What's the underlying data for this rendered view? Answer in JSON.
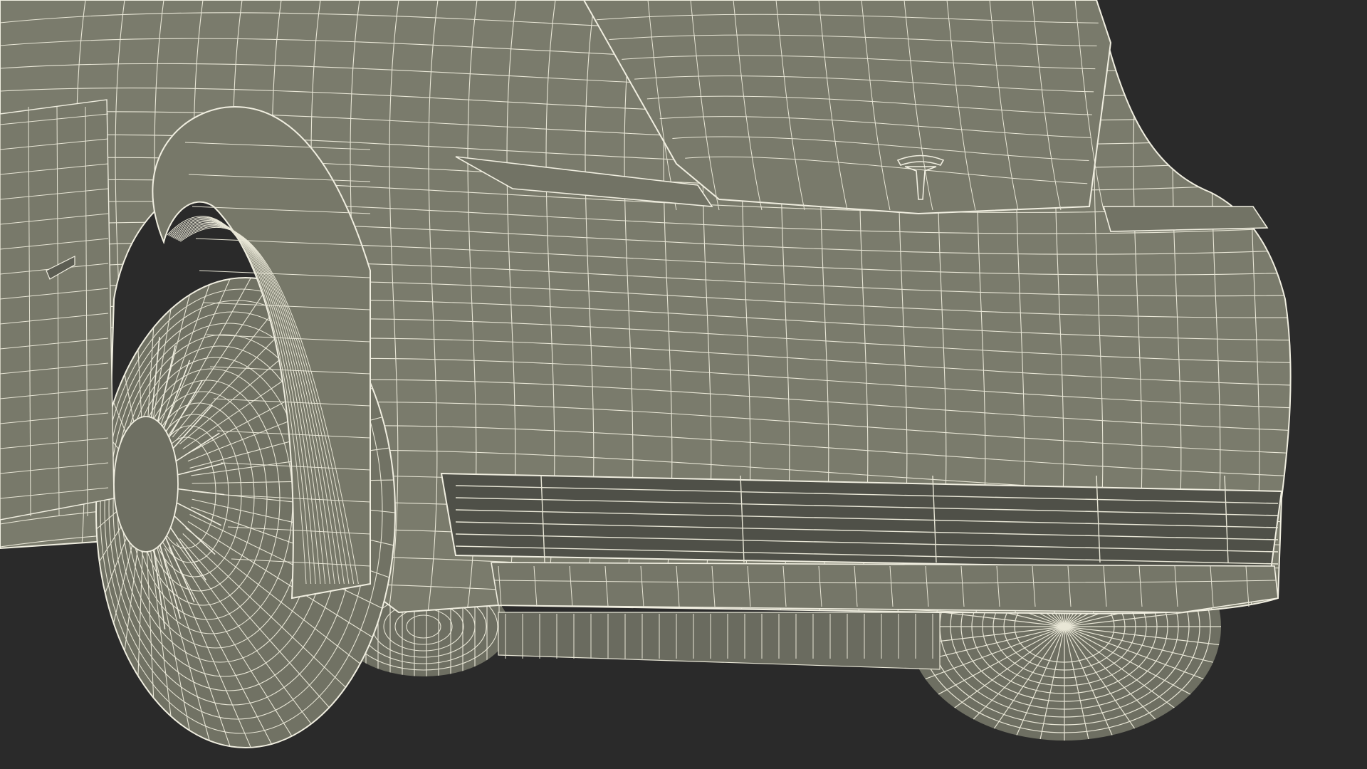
{
  "scene": {
    "subject": "car-front-wireframe",
    "background_color": "#2a2a2a",
    "body_color": "#7a7b6c",
    "body_shadow_color": "#63645a",
    "dark_cavity_color": "#4a4b44",
    "wire_color": "#e8e6d6",
    "logo_icon": "tesla-logo-icon"
  }
}
